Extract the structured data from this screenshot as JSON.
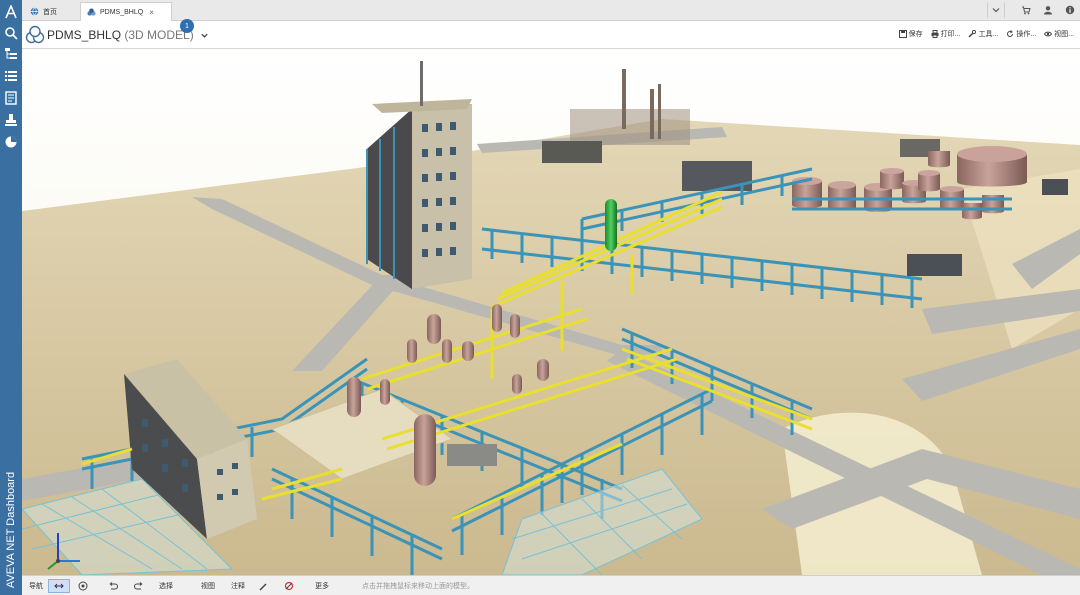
{
  "sidebar": {
    "brand_icon": "aveva-a-icon",
    "items": [
      {
        "icon": "search-icon"
      },
      {
        "icon": "hierarchy-icon"
      },
      {
        "icon": "list-icon"
      },
      {
        "icon": "document-icon"
      },
      {
        "icon": "stamp-icon"
      },
      {
        "icon": "pie-icon"
      }
    ],
    "vertical_label": "AVEVA NET Dashboard"
  },
  "tabs": [
    {
      "label": "首页",
      "icon": "globe-icon"
    },
    {
      "label": "PDMS_BHLQ",
      "icon": "model-icon",
      "active": true
    }
  ],
  "tab_close_glyph": "×",
  "header": {
    "title": "PDMS_BHLQ",
    "subtitle": "(3D MODEL)",
    "badge": "1",
    "actions": [
      "保存",
      "打印...",
      "工具...",
      "操作...",
      "视图..."
    ]
  },
  "topbar_icons": [
    "chevron-down-icon",
    "cart-icon",
    "user-icon",
    "info-icon"
  ],
  "toolbar": {
    "items": [
      "导航",
      "选择",
      "视图",
      "注释",
      "更多"
    ],
    "status": "点击并拖拽鼠标来移动上面的模型。"
  },
  "colors": {
    "sidebar": "#3a6fa2",
    "ground": "#d8c9a3",
    "road": "#b9b9b3",
    "steel": "#3b93b7",
    "pipe": "#e8df2e",
    "vessel": "#b89088"
  }
}
